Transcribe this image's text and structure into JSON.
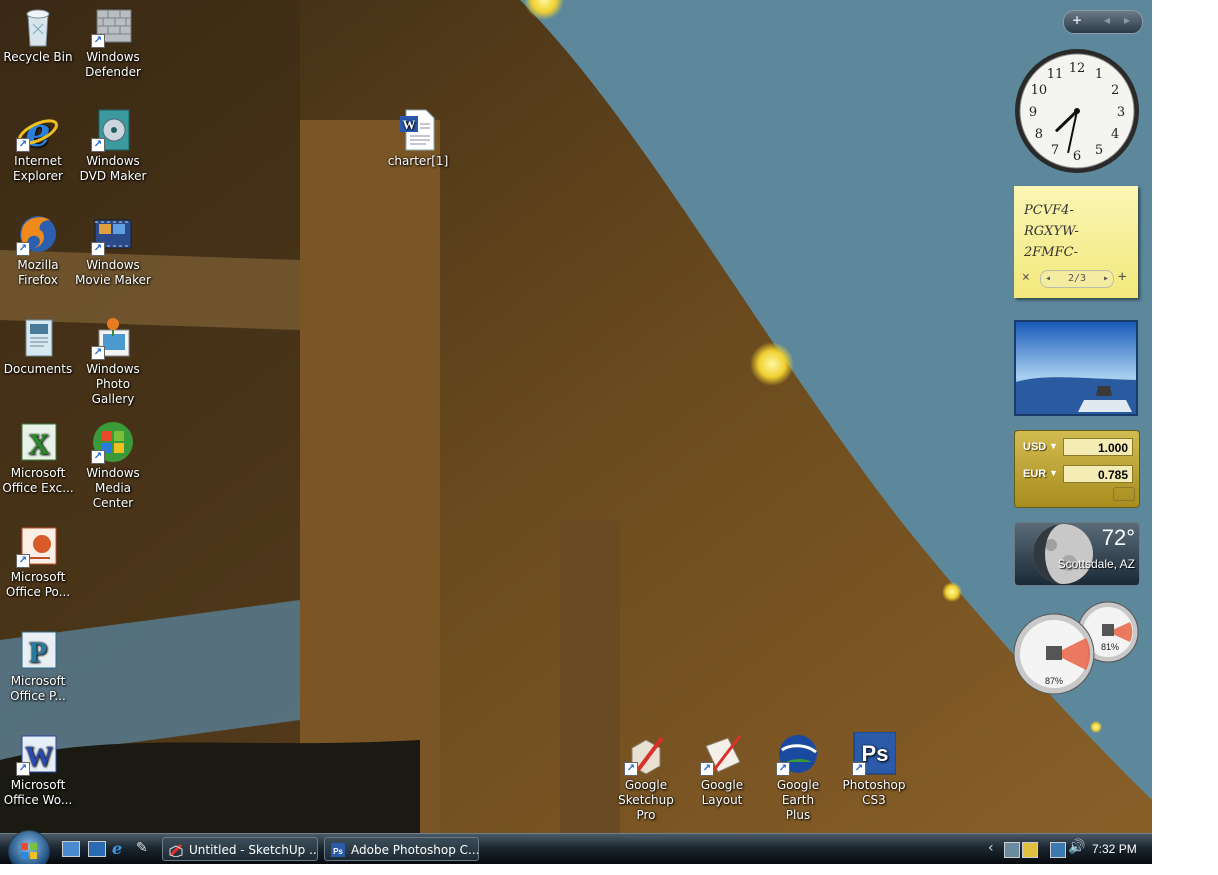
{
  "desktop": {
    "icons": [
      {
        "label": "Recycle Bin",
        "icon": "recycle-bin-icon"
      },
      {
        "label": "Windows\nDefender",
        "icon": "windows-defender-icon"
      },
      {
        "label": "Internet\nExplorer",
        "icon": "internet-explorer-icon"
      },
      {
        "label": "Windows\nDVD Maker",
        "icon": "dvd-maker-icon"
      },
      {
        "label": "Mozilla\nFirefox",
        "icon": "firefox-icon"
      },
      {
        "label": "Windows\nMovie Maker",
        "icon": "movie-maker-icon"
      },
      {
        "label": "Documents",
        "icon": "documents-icon"
      },
      {
        "label": "Windows\nPhoto Gallery",
        "icon": "photo-gallery-icon"
      },
      {
        "label": "Microsoft\nOffice Exc...",
        "icon": "excel-icon"
      },
      {
        "label": "Windows\nMedia Center",
        "icon": "media-center-icon"
      },
      {
        "label": "Microsoft\nOffice Po...",
        "icon": "powerpoint-icon"
      },
      {
        "label": "Microsoft\nOffice P...",
        "icon": "publisher-icon"
      },
      {
        "label": "Microsoft\nOffice Wo...",
        "icon": "word-icon"
      },
      {
        "label": "charter[1]",
        "icon": "word-document-icon"
      },
      {
        "label": "Google\nSketchup Pro",
        "icon": "sketchup-icon"
      },
      {
        "label": "Google\nLayout",
        "icon": "layout-icon"
      },
      {
        "label": "Google Earth\nPlus",
        "icon": "google-earth-icon"
      },
      {
        "label": "Photoshop\nCS3",
        "icon": "photoshop-icon"
      }
    ]
  },
  "sidebar": {
    "controls": {
      "add": "+",
      "prev": "◂",
      "next": "▸"
    },
    "clock": {
      "hour": 7,
      "minute": 32
    },
    "notes": {
      "lines": [
        "PCVF4-",
        "RGXYW-",
        "2FMFC-"
      ],
      "page": "2/3",
      "close": "×",
      "add": "+"
    },
    "currency": {
      "from_code": "USD",
      "from_value": "1.000",
      "to_code": "EUR",
      "to_value": "0.785"
    },
    "weather": {
      "temp": "72°",
      "city": "Scottsdale, AZ"
    },
    "meter": {
      "cpu": "87%",
      "memory": "81%"
    }
  },
  "taskbar": {
    "windows": [
      {
        "label": "Untitled - SketchUp ...",
        "icon": "sketchup-icon"
      },
      {
        "label": "Adobe Photoshop C...",
        "icon": "photoshop-icon"
      }
    ],
    "tray_arrow": "‹",
    "clock": "7:32 PM"
  },
  "colors": {
    "accent": "#1a5fd1",
    "note_yellow": "#f7ef9a",
    "currency_gold": "#b8a032"
  }
}
